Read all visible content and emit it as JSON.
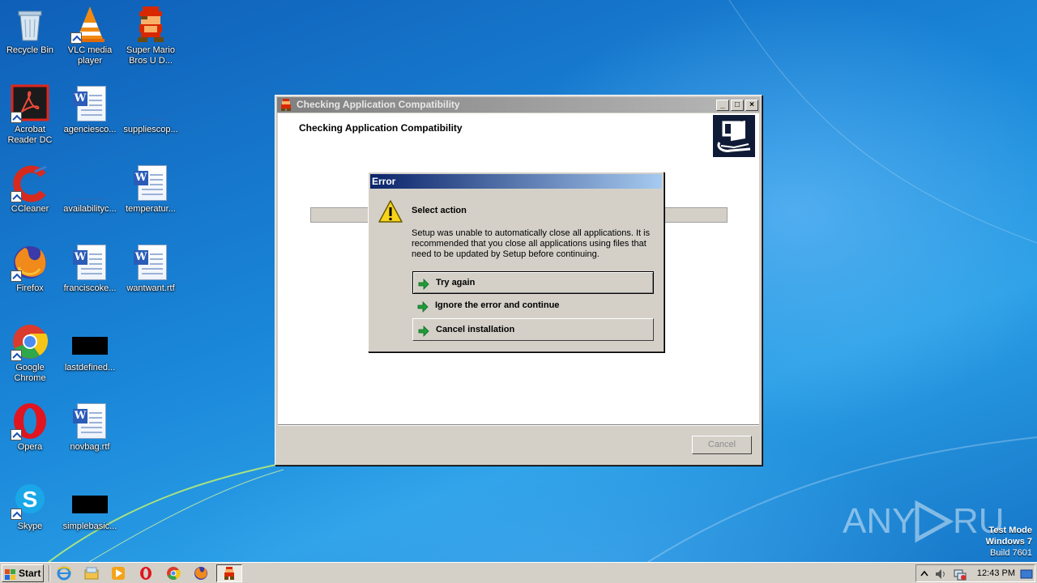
{
  "desktop": {
    "icons": [
      {
        "label": "Recycle Bin"
      },
      {
        "label": "VLC media player"
      },
      {
        "label": "Super Mario Bros U D..."
      },
      {
        "label": "Acrobat Reader DC"
      },
      {
        "label": "agenciesco..."
      },
      {
        "label": "suppliescop..."
      },
      {
        "label": "CCleaner"
      },
      {
        "label": "availabilityc..."
      },
      {
        "label": "temperatur..."
      },
      {
        "label": "Firefox"
      },
      {
        "label": "franciscoke..."
      },
      {
        "label": "wantwant.rtf"
      },
      {
        "label": "Google Chrome"
      },
      {
        "label": "lastdefined..."
      },
      {
        "label": "Opera"
      },
      {
        "label": "novbag.rtf"
      },
      {
        "label": "Skype"
      },
      {
        "label": "simplebasic..."
      }
    ]
  },
  "setup_window": {
    "title": "Checking Application Compatibility",
    "heading": "Checking Application Compatibility",
    "cancel_label": "Cancel",
    "caption_buttons": {
      "minimize": "_",
      "maximize": "□",
      "close": "×"
    }
  },
  "error_dialog": {
    "title": "Error",
    "action_title": "Select action",
    "message": "Setup was unable to automatically close all applications. It is recommended that you close all applications using files that need to be updated by Setup before continuing.",
    "options": {
      "try_again": "Try again",
      "ignore": "Ignore the error and continue",
      "cancel": "Cancel installation"
    }
  },
  "watermark": {
    "brand": "ANY RUN",
    "mode": "Test Mode",
    "os": "Windows 7",
    "build": "Build 7601"
  },
  "taskbar": {
    "start_label": "Start",
    "clock": "12:43 PM"
  },
  "colors": {
    "desktop_blue": "#1a86d8",
    "dialog_title_start": "#0a246a",
    "dialog_title_end": "#a6caf0",
    "arrow_green": "#1f9d3a"
  }
}
